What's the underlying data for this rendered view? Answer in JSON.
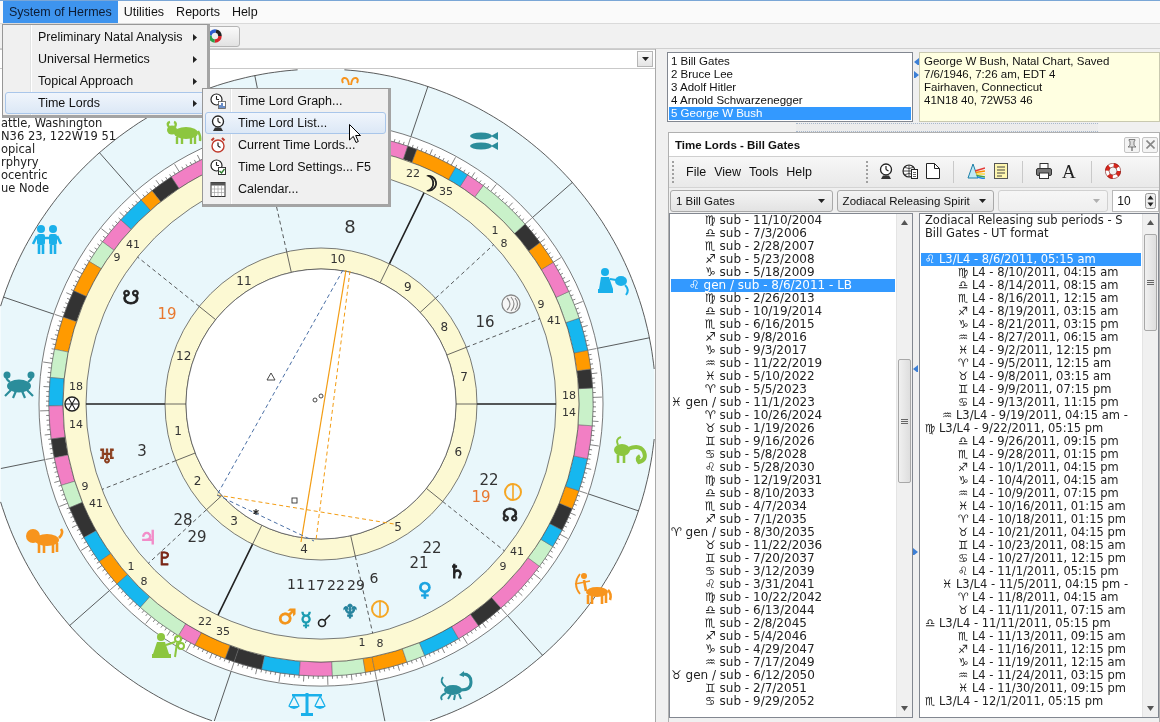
{
  "menubar": [
    {
      "label": "System of Hermes",
      "selected": true
    },
    {
      "label": "Utilities",
      "selected": false
    },
    {
      "label": "Reports",
      "selected": false
    },
    {
      "label": "Help",
      "selected": false
    }
  ],
  "menu": [
    {
      "label": "Preliminary Natal Analysis",
      "selected": false
    },
    {
      "label": "Universal Hermetics",
      "selected": false
    },
    {
      "label": "Topical Approach",
      "selected": false
    },
    {
      "label": "Time Lords",
      "selected": true
    }
  ],
  "submenu": [
    {
      "label": "Time Lord Graph...",
      "selected": false
    },
    {
      "label": "Time Lord List...",
      "selected": true
    },
    {
      "label": "Current Time Lords...",
      "selected": false
    },
    {
      "label": "Time Lord Settings...",
      "shortcut": "F5",
      "selected": false
    },
    {
      "label": "Calendar...",
      "selected": false
    }
  ],
  "chart": {
    "info_lines": [
      "attle, Washington",
      "N36 23, 122W19 51",
      "opical",
      "rphyry",
      "ocentric",
      "ue Node"
    ],
    "house_numbers": [
      "1",
      "2",
      "3",
      "4",
      "5",
      "6",
      "7",
      "8",
      "9",
      "10",
      "11",
      "12"
    ],
    "cusp_degrees": [
      {
        "degrees": "18",
        "minutes": "14"
      },
      {
        "degrees": "9",
        "minutes": "41"
      },
      {
        "degrees": "1",
        "minutes": "8"
      },
      {
        "degrees": "22",
        "minutes": "35"
      },
      {
        "degrees": "1",
        "minutes": "8"
      },
      {
        "degrees": "9",
        "minutes": "41"
      },
      {
        "degrees": "18",
        "minutes": "14"
      },
      {
        "degrees": "9",
        "minutes": "41"
      },
      {
        "degrees": "1",
        "minutes": "8"
      },
      {
        "degrees": "22",
        "minutes": "35"
      },
      {
        "degrees": "9",
        "minutes": "41"
      }
    ],
    "planets": [
      {
        "glyph": "☽",
        "color": "#222222"
      },
      {
        "glyph": "☋",
        "color": "#222222"
      },
      {
        "glyph": "♅",
        "color": "#8a3d1c"
      },
      {
        "glyph": "♃",
        "color": "#f28cc8"
      },
      {
        "glyph": "♇",
        "color": "#7a2514"
      },
      {
        "glyph": "☊",
        "color": "#222222"
      },
      {
        "glyph": "♄",
        "color": "#222222"
      },
      {
        "glyph": "♀",
        "color": "#1aa3e0"
      },
      {
        "glyph": "♂",
        "color": "#f39419"
      },
      {
        "glyph": "☿",
        "color": "#1a9bb0"
      },
      {
        "glyph": "♆",
        "color": "#23819c"
      }
    ],
    "degree_labels": [
      {
        "text": "8",
        "color": "#333333"
      },
      {
        "text": "19",
        "color": "#e8772e"
      },
      {
        "text": "16",
        "color": "#333333"
      },
      {
        "text": "3",
        "color": "#333333"
      },
      {
        "text": "28",
        "color": "#333333"
      },
      {
        "text": "29",
        "color": "#333333"
      },
      {
        "text": "22",
        "color": "#333333"
      },
      {
        "text": "19",
        "color": "#e8772e"
      },
      {
        "text": "22",
        "color": "#333333"
      },
      {
        "text": "21",
        "color": "#333333"
      },
      {
        "text": "11",
        "color": "#333333"
      },
      {
        "text": "17",
        "color": "#333333"
      },
      {
        "text": "22",
        "color": "#333333"
      },
      {
        "text": "29",
        "color": "#333333"
      },
      {
        "text": "6",
        "color": "#333333"
      }
    ]
  },
  "charts_list": [
    {
      "label": "1 Bill Gates",
      "selected": false
    },
    {
      "label": "2 Bruce Lee",
      "selected": false
    },
    {
      "label": "3 Adolf Hitler",
      "selected": false
    },
    {
      "label": "4 Arnold Schwarzenegger",
      "selected": false
    },
    {
      "label": "5 George W Bush",
      "selected": true
    }
  ],
  "chart_info": [
    "George W Bush, Natal Chart, Saved",
    "7/6/1946, 7:26 am, EDT 4",
    "Fairhaven, Connecticut",
    "41N18 40, 72W53 46"
  ],
  "time_lords": {
    "title": "Time Lords - Bill Gates",
    "menu": [
      "File",
      "View",
      "Tools",
      "Help"
    ],
    "font_button": "A",
    "chart_select": "1 Bill Gates",
    "method_select": "Zodiacal Releasing Spirit",
    "third_select": {
      "disabled": true
    },
    "spinner": "10",
    "periods": [
      {
        "text": "♍ sub - 11/10/2004",
        "kind": "sub",
        "selected": false
      },
      {
        "text": "♎ sub - 7/3/2006",
        "kind": "sub",
        "selected": false
      },
      {
        "text": "♏ sub - 2/28/2007",
        "kind": "sub",
        "selected": false
      },
      {
        "text": "♐ sub - 5/23/2008",
        "kind": "sub",
        "selected": false
      },
      {
        "text": "♑ sub - 5/18/2009",
        "kind": "sub",
        "selected": false
      },
      {
        "text": "♌ gen / sub - 8/6/2011 - LB",
        "kind": "lb",
        "selected": true
      },
      {
        "text": "♍ sub - 2/26/2013",
        "kind": "sub",
        "selected": false
      },
      {
        "text": "♎ sub - 10/19/2014",
        "kind": "sub",
        "selected": false
      },
      {
        "text": "♏ sub - 6/16/2015",
        "kind": "sub",
        "selected": false
      },
      {
        "text": "♐ sub - 9/8/2016",
        "kind": "sub",
        "selected": false
      },
      {
        "text": "♑ sub - 9/3/2017",
        "kind": "sub",
        "selected": false
      },
      {
        "text": "♒ sub - 11/22/2019",
        "kind": "sub",
        "selected": false
      },
      {
        "text": "♓ sub - 5/10/2022",
        "kind": "sub",
        "selected": false
      },
      {
        "text": "♈ sub - 5/5/2023",
        "kind": "sub",
        "selected": false
      },
      {
        "text": "♓ gen / sub - 11/1/2023",
        "kind": "gen",
        "selected": false
      },
      {
        "text": "♈ sub - 10/26/2024",
        "kind": "sub",
        "selected": false
      },
      {
        "text": "♉ sub - 1/19/2026",
        "kind": "sub",
        "selected": false
      },
      {
        "text": "♊ sub - 9/16/2026",
        "kind": "sub",
        "selected": false
      },
      {
        "text": "♋ sub - 5/8/2028",
        "kind": "sub",
        "selected": false
      },
      {
        "text": "♌ sub - 5/28/2030",
        "kind": "sub",
        "selected": false
      },
      {
        "text": "♍ sub - 12/19/2031",
        "kind": "sub",
        "selected": false
      },
      {
        "text": "♎ sub - 8/10/2033",
        "kind": "sub",
        "selected": false
      },
      {
        "text": "♏ sub - 4/7/2034",
        "kind": "sub",
        "selected": false
      },
      {
        "text": "♐ sub - 7/1/2035",
        "kind": "sub",
        "selected": false
      },
      {
        "text": "♈ gen / sub - 8/30/2035",
        "kind": "gen",
        "selected": false
      },
      {
        "text": "♉ sub - 11/22/2036",
        "kind": "sub",
        "selected": false
      },
      {
        "text": "♊ sub - 7/20/2037",
        "kind": "sub",
        "selected": false
      },
      {
        "text": "♋ sub - 3/12/2039",
        "kind": "sub",
        "selected": false
      },
      {
        "text": "♌ sub - 3/31/2041",
        "kind": "sub",
        "selected": false
      },
      {
        "text": "♍ sub - 10/22/2042",
        "kind": "sub",
        "selected": false
      },
      {
        "text": "♎ sub - 6/13/2044",
        "kind": "sub",
        "selected": false
      },
      {
        "text": "♏ sub - 2/8/2045",
        "kind": "sub",
        "selected": false
      },
      {
        "text": "♐ sub - 5/4/2046",
        "kind": "sub",
        "selected": false
      },
      {
        "text": "♑ sub - 4/29/2047",
        "kind": "sub",
        "selected": false
      },
      {
        "text": "♒ sub - 7/17/2049",
        "kind": "sub",
        "selected": false
      },
      {
        "text": "♉ gen / sub - 6/12/2050",
        "kind": "gen",
        "selected": false
      },
      {
        "text": "♊ sub - 2/7/2051",
        "kind": "sub",
        "selected": false
      },
      {
        "text": "♋ sub - 9/29/2052",
        "kind": "sub",
        "selected": false
      }
    ],
    "sub_periods": {
      "heading": [
        "Zodiacal Releasing sub periods - S",
        "Bill Gates - UT format"
      ],
      "rows": [
        {
          "text": "♌ L3/L4 - 8/6/2011, 05:15 am",
          "kind": "l3",
          "selected": true
        },
        {
          "text": "♍ L4 - 8/10/2011, 04:15 am",
          "kind": "l4",
          "selected": false
        },
        {
          "text": "♎ L4 - 8/14/2011, 08:15 am",
          "kind": "l4",
          "selected": false
        },
        {
          "text": "♏ L4 - 8/16/2011, 12:15 am",
          "kind": "l4",
          "selected": false
        },
        {
          "text": "♐ L4 - 8/19/2011, 03:15 am",
          "kind": "l4",
          "selected": false
        },
        {
          "text": "♑ L4 - 8/21/2011, 03:15 pm",
          "kind": "l4",
          "selected": false
        },
        {
          "text": "♒ L4 - 8/27/2011, 06:15 am",
          "kind": "l4",
          "selected": false
        },
        {
          "text": "♓ L4 - 9/2/2011, 12:15 pm",
          "kind": "l4",
          "selected": false
        },
        {
          "text": "♈ L4 - 9/5/2011, 12:15 am",
          "kind": "l4",
          "selected": false
        },
        {
          "text": "♉ L4 - 9/8/2011, 03:15 am",
          "kind": "l4",
          "selected": false
        },
        {
          "text": "♊ L4 - 9/9/2011, 07:15 pm",
          "kind": "l4",
          "selected": false
        },
        {
          "text": "♋ L4 - 9/13/2011, 11:15 pm",
          "kind": "l4",
          "selected": false
        },
        {
          "text": "♒ L3/L4 - 9/19/2011, 04:15 am -",
          "kind": "lb",
          "selected": false
        },
        {
          "text": "♍ L3/L4 - 9/22/2011, 05:15 pm",
          "kind": "l3",
          "selected": false
        },
        {
          "text": "♎ L4 - 9/26/2011, 09:15 pm",
          "kind": "l4",
          "selected": false
        },
        {
          "text": "♏ L4 - 9/28/2011, 01:15 pm",
          "kind": "l4",
          "selected": false
        },
        {
          "text": "♐ L4 - 10/1/2011, 04:15 pm",
          "kind": "l4",
          "selected": false
        },
        {
          "text": "♑ L4 - 10/4/2011, 04:15 am",
          "kind": "l4",
          "selected": false
        },
        {
          "text": "♒ L4 - 10/9/2011, 07:15 pm",
          "kind": "l4",
          "selected": false
        },
        {
          "text": "♓ L4 - 10/16/2011, 01:15 am",
          "kind": "l4",
          "selected": false
        },
        {
          "text": "♈ L4 - 10/18/2011, 01:15 pm",
          "kind": "l4",
          "selected": false
        },
        {
          "text": "♉ L4 - 10/21/2011, 04:15 pm",
          "kind": "l4",
          "selected": false
        },
        {
          "text": "♊ L4 - 10/23/2011, 08:15 am",
          "kind": "l4",
          "selected": false
        },
        {
          "text": "♋ L4 - 10/27/2011, 12:15 pm",
          "kind": "l4",
          "selected": false
        },
        {
          "text": "♌ L4 - 11/1/2011, 05:15 pm",
          "kind": "l4",
          "selected": false
        },
        {
          "text": "♓ L3/L4 - 11/5/2011, 04:15 pm -",
          "kind": "lb",
          "selected": false
        },
        {
          "text": "♈ L4 - 11/8/2011, 04:15 am",
          "kind": "l4",
          "selected": false
        },
        {
          "text": "♉ L4 - 11/11/2011, 07:15 am",
          "kind": "l4",
          "selected": false
        },
        {
          "text": "♎ L3/L4 - 11/11/2011, 05:15 pm",
          "kind": "l3",
          "selected": false
        },
        {
          "text": "♏ L4 - 11/13/2011, 09:15 am",
          "kind": "l4",
          "selected": false
        },
        {
          "text": "♐ L4 - 11/16/2011, 12:15 pm",
          "kind": "l4",
          "selected": false
        },
        {
          "text": "♑ L4 - 11/19/2011, 12:15 am",
          "kind": "l4",
          "selected": false
        },
        {
          "text": "♒ L4 - 11/24/2011, 03:15 pm",
          "kind": "l4",
          "selected": false
        },
        {
          "text": "♓ L4 - 11/30/2011, 09:15 pm",
          "kind": "l4",
          "selected": false
        },
        {
          "text": "♏ L3/L4 - 12/1/2011, 05:15 pm",
          "kind": "l3",
          "selected": false
        }
      ]
    }
  }
}
